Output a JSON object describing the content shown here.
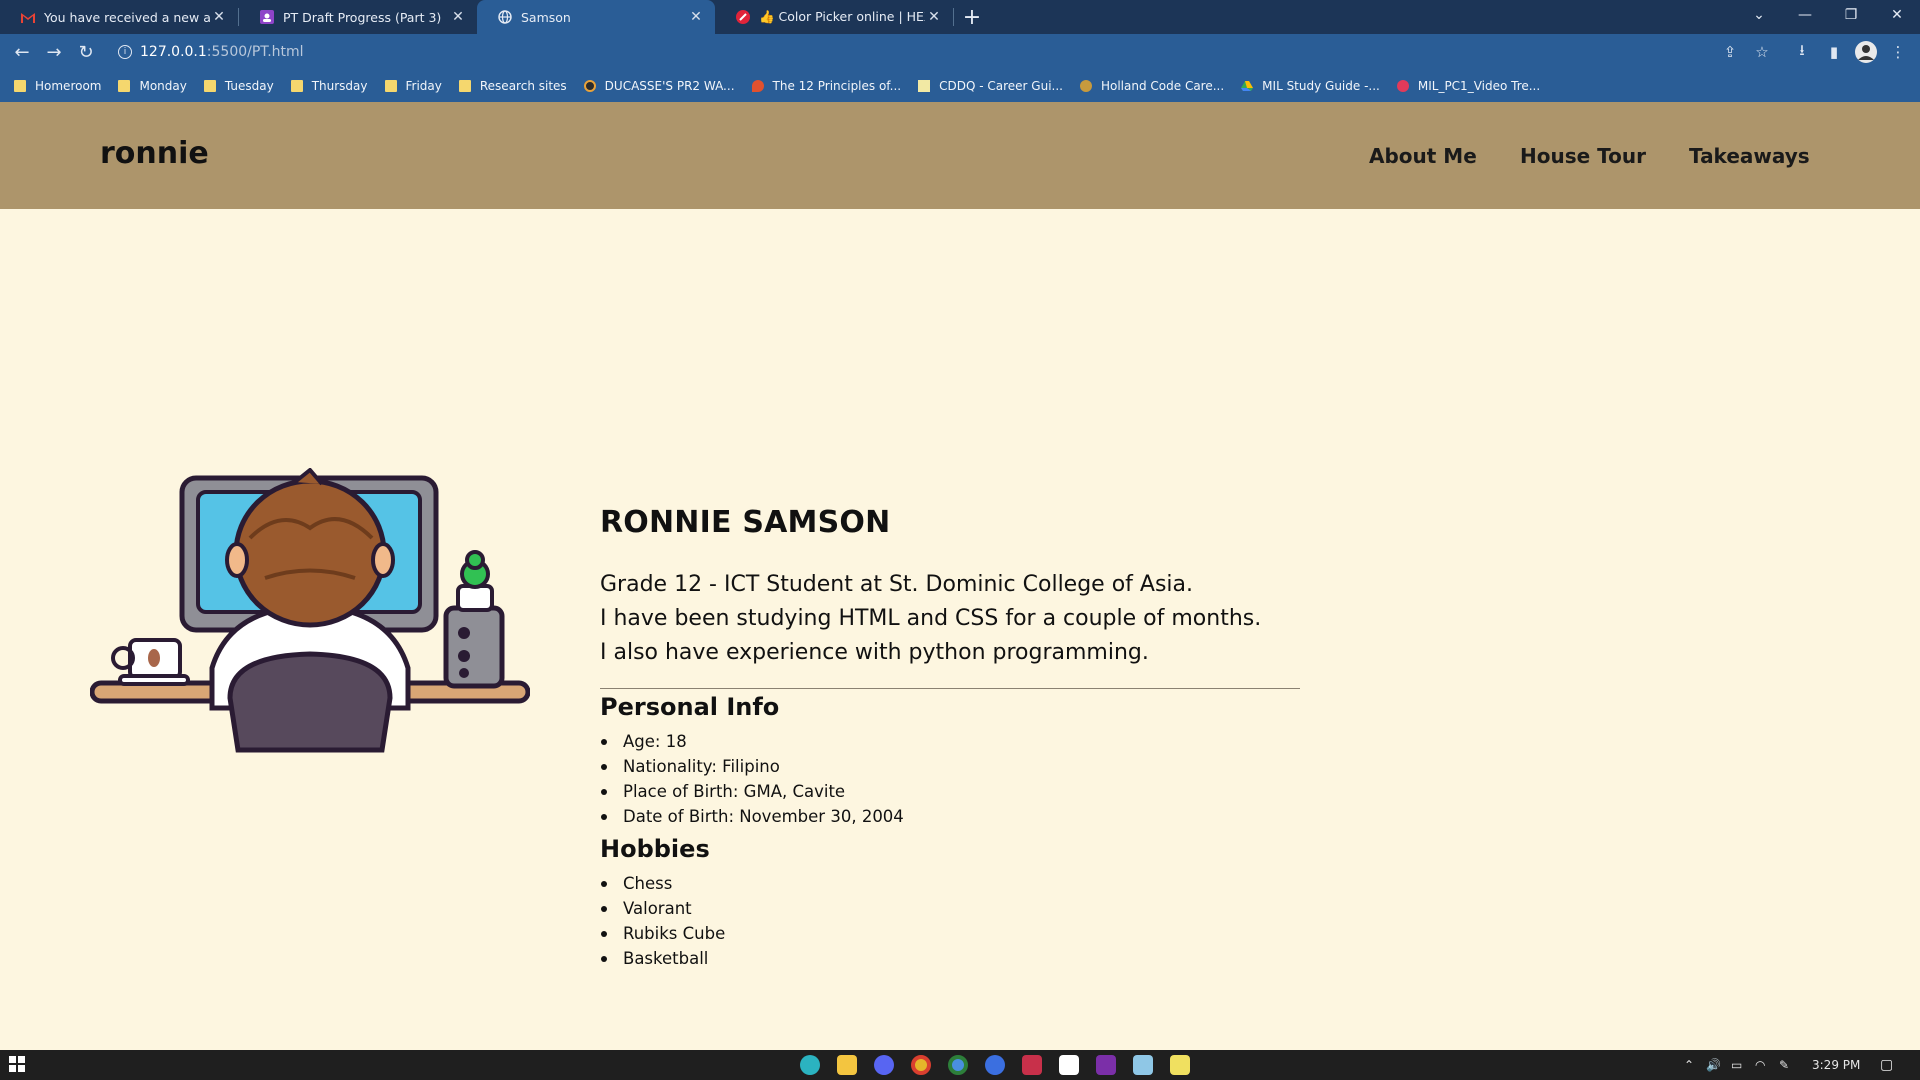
{
  "browser": {
    "tabs": [
      {
        "title": "You have received a new assignm",
        "icon": "gmail-icon",
        "active": false
      },
      {
        "title": "PT Draft Progress (Part 3)",
        "icon": "classroom-icon",
        "active": false
      },
      {
        "title": "Samson",
        "icon": "globe-icon",
        "active": true
      },
      {
        "title": "👍 Color Picker online | HEX Colo",
        "icon": "color-picker-icon",
        "active": false
      }
    ],
    "url_host": "127.0.0.1",
    "url_path": ":5500/PT.html",
    "bookmarks": [
      {
        "label": "Homeroom",
        "icon": "folder-icon"
      },
      {
        "label": "Monday",
        "icon": "folder-icon"
      },
      {
        "label": "Tuesday",
        "icon": "folder-icon"
      },
      {
        "label": "Thursday",
        "icon": "folder-icon"
      },
      {
        "label": "Friday",
        "icon": "folder-icon"
      },
      {
        "label": "Research sites",
        "icon": "folder-icon"
      },
      {
        "label": "DUCASSE'S PR2 WA...",
        "icon": "site-icon"
      },
      {
        "label": "The 12 Principles of...",
        "icon": "site-icon"
      },
      {
        "label": "CDDQ - Career Gui...",
        "icon": "site-icon"
      },
      {
        "label": "Holland Code Care...",
        "icon": "site-icon"
      },
      {
        "label": "MIL Study Guide -...",
        "icon": "drive-icon"
      },
      {
        "label": "MIL_PC1_Video Tre...",
        "icon": "site-icon"
      }
    ]
  },
  "site": {
    "logo": "ronnie",
    "nav": [
      "About Me",
      "House Tour",
      "Takeaways"
    ],
    "colors": {
      "header": "#ad956b",
      "background": "#fdf6e0"
    }
  },
  "profile": {
    "name": "RONNIE SAMSON",
    "bio": [
      "Grade 12 - ICT Student at St. Dominic College of Asia.",
      "I have been studying HTML and CSS for a couple of months.",
      "I also have experience with python programming."
    ],
    "personal_heading": "Personal Info",
    "personal": [
      "Age: 18",
      "Nationality: Filipino",
      "Place of Birth: GMA, Cavite",
      "Date of Birth: November 30, 2004"
    ],
    "hobbies_heading": "Hobbies",
    "hobbies": [
      "Chess",
      "Valorant",
      "Rubiks Cube",
      "Basketball"
    ]
  },
  "taskbar": {
    "time": "3:29 PM"
  }
}
